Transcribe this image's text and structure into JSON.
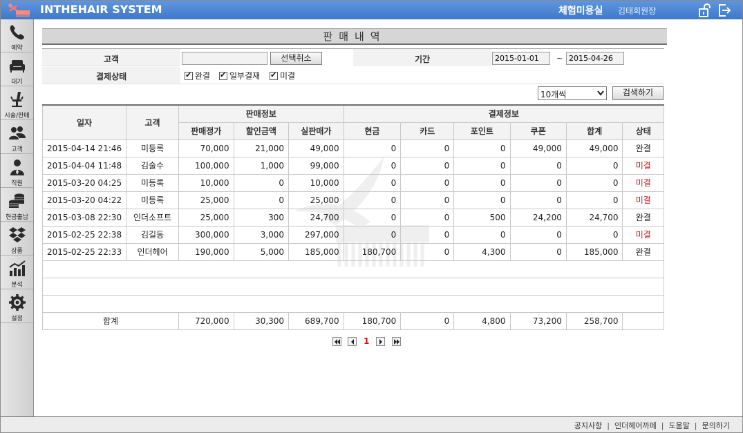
{
  "header": {
    "title": "INTHEHAIR SYSTEM",
    "salon": "체험미용실",
    "user": "김태희원장"
  },
  "sidebar": {
    "items": [
      {
        "label": "예약",
        "icon": "phone-icon"
      },
      {
        "label": "대기",
        "icon": "sofa-icon"
      },
      {
        "label": "시술/판매",
        "icon": "salon-chair-icon"
      },
      {
        "label": "고객",
        "icon": "customers-icon"
      },
      {
        "label": "직원",
        "icon": "staff-icon"
      },
      {
        "label": "현금출납",
        "icon": "coins-icon"
      },
      {
        "label": "상품",
        "icon": "dropbox-icon"
      },
      {
        "label": "분석",
        "icon": "chart-icon"
      },
      {
        "label": "설정",
        "icon": "gear-icon"
      }
    ]
  },
  "page": {
    "title": "판매내역"
  },
  "filter": {
    "customer_label": "고객",
    "customer_value": "",
    "clear_button": "선택취소",
    "period_label": "기간",
    "date_from": "2015-01-01",
    "date_sep": "~",
    "date_to": "2015-04-26",
    "status_label": "결제상태",
    "checkboxes": [
      {
        "label": "완결",
        "checked": true
      },
      {
        "label": "일부결재",
        "checked": true
      },
      {
        "label": "미결",
        "checked": true
      }
    ],
    "page_size": "10개씩",
    "search_button": "검색하기"
  },
  "table": {
    "group_headers": {
      "date": "일자",
      "customer": "고객",
      "sales": "판매정보",
      "payment": "결제정보"
    },
    "sub_headers": [
      "판매정가",
      "할인금액",
      "실판매가",
      "현금",
      "카드",
      "포인트",
      "쿠폰",
      "합계",
      "상태"
    ],
    "rows": [
      {
        "date": "2015-04-14 21:46",
        "customer": "미등록",
        "list": "70,000",
        "discount": "21,000",
        "actual": "49,000",
        "cash": "0",
        "card": "0",
        "point": "0",
        "coupon": "49,000",
        "total": "49,000",
        "status": "완결"
      },
      {
        "date": "2015-04-04 11:48",
        "customer": "김술수",
        "list": "100,000",
        "discount": "1,000",
        "actual": "99,000",
        "cash": "0",
        "card": "0",
        "point": "0",
        "coupon": "0",
        "total": "0",
        "status": "미결"
      },
      {
        "date": "2015-03-20 04:25",
        "customer": "미등록",
        "list": "10,000",
        "discount": "0",
        "actual": "10,000",
        "cash": "0",
        "card": "0",
        "point": "0",
        "coupon": "0",
        "total": "0",
        "status": "미결"
      },
      {
        "date": "2015-03-20 04:22",
        "customer": "미등록",
        "list": "25,000",
        "discount": "0",
        "actual": "25,000",
        "cash": "0",
        "card": "0",
        "point": "0",
        "coupon": "0",
        "total": "0",
        "status": "미결"
      },
      {
        "date": "2015-03-08 22:30",
        "customer": "인더소프트",
        "list": "25,000",
        "discount": "300",
        "actual": "24,700",
        "cash": "0",
        "card": "0",
        "point": "500",
        "coupon": "24,200",
        "total": "24,700",
        "status": "완결"
      },
      {
        "date": "2015-02-25 22:38",
        "customer": "김길동",
        "list": "300,000",
        "discount": "3,000",
        "actual": "297,000",
        "cash": "0",
        "card": "0",
        "point": "0",
        "coupon": "0",
        "total": "0",
        "status": "미결"
      },
      {
        "date": "2015-02-25 22:33",
        "customer": "인더헤어",
        "list": "190,000",
        "discount": "5,000",
        "actual": "185,000",
        "cash": "180,700",
        "card": "0",
        "point": "4,300",
        "coupon": "0",
        "total": "185,000",
        "status": "완결"
      }
    ],
    "totals": {
      "label": "합계",
      "list": "720,000",
      "discount": "30,300",
      "actual": "689,700",
      "cash": "180,700",
      "card": "0",
      "point": "4,800",
      "coupon": "73,200",
      "total": "258,700"
    }
  },
  "pagination": {
    "current": "1"
  },
  "footer": {
    "links": [
      "공지사항",
      "인더헤어까페",
      "도움말",
      "문의하기"
    ]
  },
  "colors": {
    "header_blue": "#4a84d2",
    "status_unpaid": "#d01010",
    "page_current": "#d01010"
  }
}
